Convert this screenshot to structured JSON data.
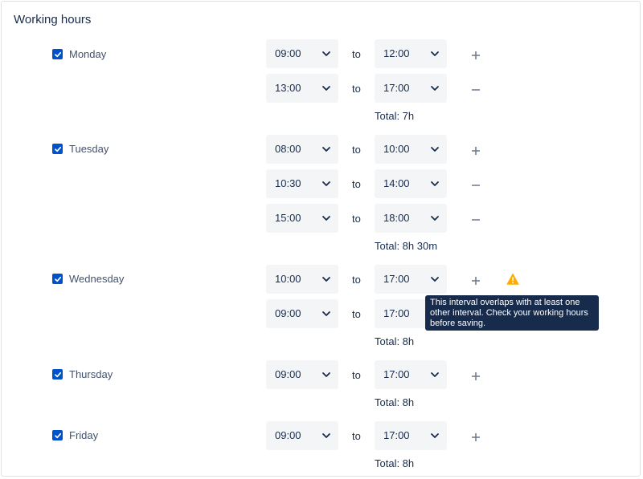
{
  "title": "Working hours",
  "to_label": "to",
  "tooltip": "This interval overlaps with at least one other interval. Check your working hours before saving.",
  "days": [
    {
      "name": "Monday",
      "checked": true,
      "intervals": [
        {
          "from": "09:00",
          "to": "12:00",
          "action": "add"
        },
        {
          "from": "13:00",
          "to": "17:00",
          "action": "remove"
        }
      ],
      "total": "Total: 7h"
    },
    {
      "name": "Tuesday",
      "checked": true,
      "intervals": [
        {
          "from": "08:00",
          "to": "10:00",
          "action": "add"
        },
        {
          "from": "10:30",
          "to": "14:00",
          "action": "remove"
        },
        {
          "from": "15:00",
          "to": "18:00",
          "action": "remove"
        }
      ],
      "total": "Total: 8h 30m"
    },
    {
      "name": "Wednesday",
      "checked": true,
      "intervals": [
        {
          "from": "10:00",
          "to": "17:00",
          "action": "add",
          "warning": true
        },
        {
          "from": "09:00",
          "to": "17:00",
          "action": "remove"
        }
      ],
      "total": "Total: 8h"
    },
    {
      "name": "Thursday",
      "checked": true,
      "intervals": [
        {
          "from": "09:00",
          "to": "17:00",
          "action": "add"
        }
      ],
      "total": "Total: 8h"
    },
    {
      "name": "Friday",
      "checked": true,
      "intervals": [
        {
          "from": "09:00",
          "to": "17:00",
          "action": "add"
        }
      ],
      "total": "Total: 8h"
    }
  ],
  "colors": {
    "checkbox": "#0052cc",
    "select_bg": "#f4f5f7",
    "tooltip_bg": "#172b4d",
    "warning": "#ffab00"
  },
  "icons": {
    "checkbox": "check-icon",
    "dropdown": "chevron-down-icon",
    "add": "plus-icon",
    "remove": "minus-icon",
    "warning": "warning-icon"
  }
}
